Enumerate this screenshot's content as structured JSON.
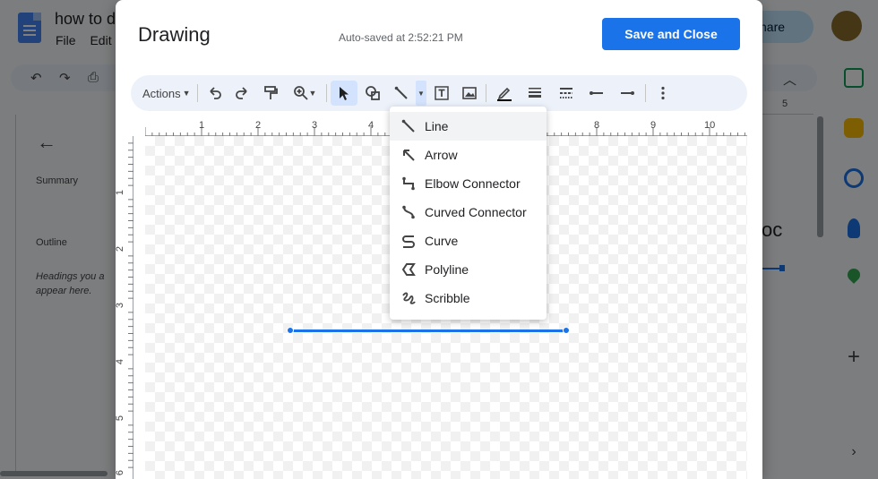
{
  "background": {
    "doc_title": "how to d",
    "menu": [
      "File",
      "Edit"
    ],
    "share_label": "hare",
    "outline": {
      "summary": "Summary",
      "outline_label": "Outline",
      "hint": "Headings you a appear here."
    },
    "doc_text": "oc",
    "hruler_num": "5"
  },
  "dialog": {
    "title": "Drawing",
    "autosave": "Auto-saved at 2:52:21 PM",
    "save_button": "Save and Close"
  },
  "toolbar": {
    "actions_label": "Actions"
  },
  "ruler": {
    "h_ticks": [
      "1",
      "2",
      "3",
      "4",
      "8",
      "9",
      "10"
    ],
    "v_ticks": [
      "1",
      "2",
      "3",
      "4",
      "5",
      "6"
    ]
  },
  "line_menu": {
    "items": [
      {
        "label": "Line",
        "icon": "line-icon"
      },
      {
        "label": "Arrow",
        "icon": "arrow-icon"
      },
      {
        "label": "Elbow Connector",
        "icon": "elbow-connector-icon"
      },
      {
        "label": "Curved Connector",
        "icon": "curved-connector-icon"
      },
      {
        "label": "Curve",
        "icon": "curve-icon"
      },
      {
        "label": "Polyline",
        "icon": "polyline-icon"
      },
      {
        "label": "Scribble",
        "icon": "scribble-icon"
      }
    ]
  },
  "colors": {
    "accent": "#1a73e8",
    "toolbar_bg": "#edf2fa",
    "selected_tool": "#d3e3fd"
  }
}
